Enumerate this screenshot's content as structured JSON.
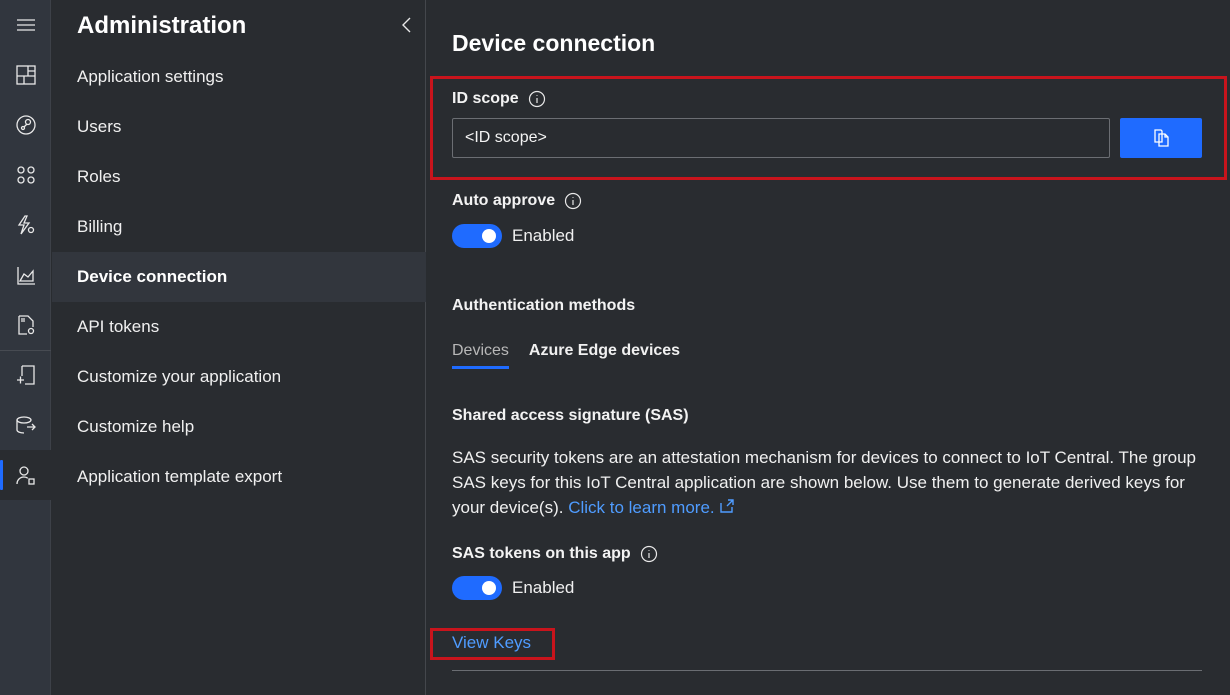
{
  "rail": {
    "items": [
      {
        "icon": "hamburger-menu-icon"
      },
      {
        "icon": "dashboard-icon"
      },
      {
        "icon": "devices-icon"
      },
      {
        "icon": "device-groups-icon"
      },
      {
        "icon": "rules-icon"
      },
      {
        "icon": "analytics-icon"
      },
      {
        "icon": "jobs-icon"
      },
      {
        "icon": "device-templates-icon"
      },
      {
        "icon": "data-export-icon"
      },
      {
        "icon": "administration-icon",
        "active": true
      }
    ]
  },
  "nav": {
    "title": "Administration",
    "collapse_icon": "chevron-left-icon",
    "items": [
      {
        "label": "Application settings"
      },
      {
        "label": "Users"
      },
      {
        "label": "Roles"
      },
      {
        "label": "Billing"
      },
      {
        "label": "Device connection",
        "active": true
      },
      {
        "label": "API tokens"
      },
      {
        "label": "Customize your application"
      },
      {
        "label": "Customize help"
      },
      {
        "label": "Application template export"
      }
    ]
  },
  "main": {
    "title": "Device connection",
    "id_scope": {
      "label": "ID scope",
      "value": "<ID scope>",
      "copy_icon": "copy-icon"
    },
    "auto_approve": {
      "label": "Auto approve",
      "state": "Enabled",
      "on": true
    },
    "auth_methods": {
      "title": "Authentication methods",
      "tabs": [
        {
          "label": "Devices",
          "active": true
        },
        {
          "label": "Azure Edge devices"
        }
      ]
    },
    "sas": {
      "title": "Shared access signature (SAS)",
      "description": "SAS security tokens are an attestation mechanism for devices to connect to IoT Central. The group SAS keys for this IoT Central application are shown below. Use them to generate derived keys for your device(s). ",
      "learn_more": "Click to learn more.",
      "tokens_label": "SAS tokens on this app",
      "tokens_state": "Enabled",
      "tokens_on": true,
      "view_keys": "View Keys"
    },
    "highlight_color": "#c8141c",
    "accent_color": "#1f6bff",
    "link_color": "#4f9cff"
  }
}
